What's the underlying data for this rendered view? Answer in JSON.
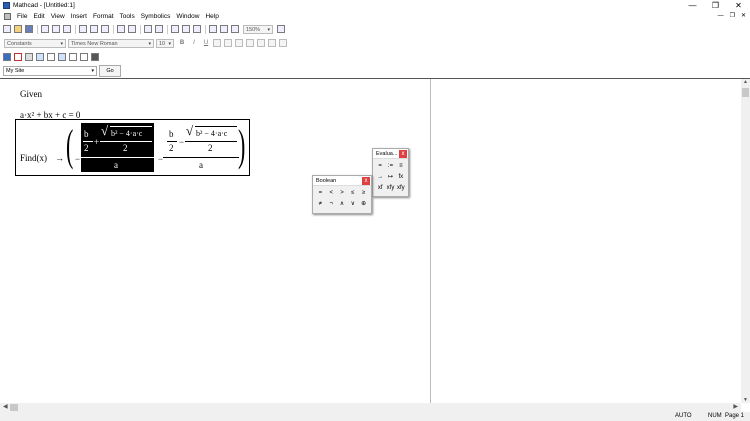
{
  "window": {
    "title": "Mathcad - [Untitled:1]",
    "minimize": "—",
    "restore": "❐",
    "close": "✕"
  },
  "menubar": {
    "items": [
      "File",
      "Edit",
      "View",
      "Insert",
      "Format",
      "Tools",
      "Symbolics",
      "Window",
      "Help"
    ],
    "doc_controls": [
      "—",
      "❐",
      "✕"
    ]
  },
  "toolbar": {
    "zoom": "150%"
  },
  "format_bar": {
    "style": "Constants",
    "font": "Times New Roman",
    "size": "10",
    "buttons": [
      "B",
      "I",
      "U"
    ]
  },
  "address_bar": {
    "value": "My Site",
    "go_label": "Go"
  },
  "worksheet": {
    "given_label": "Given",
    "equation": "a·x² + bx + c = 0",
    "find_label": "Find(x)",
    "arrow": "→",
    "b": "b",
    "two": "2",
    "a": "a",
    "plus": "+",
    "minus": "−",
    "radicand": "b² − 4·a·c"
  },
  "palettes": {
    "evaluation": {
      "title": "Evalua...",
      "close": "x",
      "buttons": [
        "=",
        ":=",
        "≡",
        "→",
        "↦",
        "fx",
        "xf",
        "xfy",
        "xfy"
      ]
    },
    "boolean": {
      "title": "Boolean",
      "close": "x",
      "buttons": [
        "=",
        "<",
        ">",
        "≤",
        "≥",
        "≠",
        "¬",
        "∧",
        "∨",
        "⊕"
      ]
    }
  },
  "statusbar": {
    "mode": "AUTO",
    "num": "NUM",
    "page": "Page 1"
  }
}
